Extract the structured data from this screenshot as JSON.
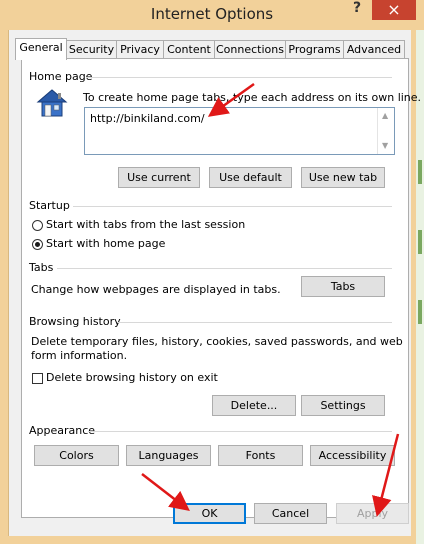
{
  "window": {
    "title": "Internet Options",
    "help": "?",
    "close": "×"
  },
  "tabs": [
    "General",
    "Security",
    "Privacy",
    "Content",
    "Connections",
    "Programs",
    "Advanced"
  ],
  "home_page": {
    "heading": "Home page",
    "description": "To create home page tabs, type each address on its own line.",
    "url": "http://binkiland.com/",
    "buttons": {
      "use_current": "Use current",
      "use_default": "Use default",
      "use_new_tab": "Use new tab"
    }
  },
  "startup": {
    "heading": "Startup",
    "options": [
      "Start with tabs from the last session",
      "Start with home page"
    ],
    "selected": "Start with home page"
  },
  "tabs_section": {
    "heading": "Tabs",
    "description": "Change how webpages are displayed in tabs.",
    "button": "Tabs"
  },
  "browsing_history": {
    "heading": "Browsing history",
    "description_line1": "Delete temporary files, history, cookies, saved passwords, and web",
    "description_line2": "form information.",
    "delete_on_exit": "Delete browsing history on exit",
    "delete_on_exit_checked": false,
    "delete_button": "Delete...",
    "settings_button": "Settings"
  },
  "appearance": {
    "heading": "Appearance",
    "buttons": {
      "colors": "Colors",
      "languages": "Languages",
      "fonts": "Fonts",
      "accessibility": "Accessibility"
    }
  },
  "footer": {
    "ok": "OK",
    "cancel": "Cancel",
    "apply": "Apply"
  },
  "colors": {
    "title_bar": "#f2d19a",
    "close": "#c7432f",
    "annotation_arrow": "#e01818"
  }
}
